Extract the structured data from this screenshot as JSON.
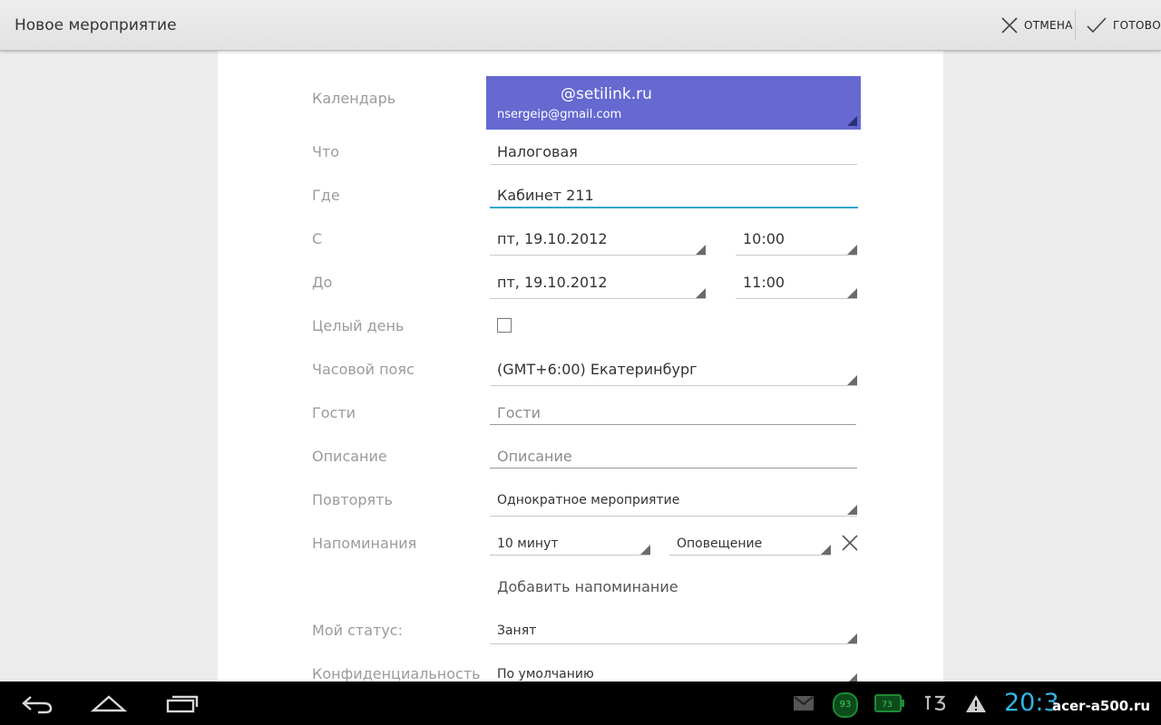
{
  "actionbar": {
    "title": "Новое мероприятие",
    "cancel_label": "ОТМЕНА",
    "done_label": "ГОТОВО"
  },
  "form": {
    "calendar": {
      "label": "Календарь",
      "name": "@setilink.ru",
      "account": "nsergeip@gmail.com",
      "color": "#6569d0"
    },
    "what": {
      "label": "Что",
      "value": "Налоговая"
    },
    "where": {
      "label": "Где",
      "value": "Кабинет 211"
    },
    "from": {
      "label": "С",
      "date": "пт, 19.10.2012",
      "time": "10:00"
    },
    "to": {
      "label": "До",
      "date": "пт, 19.10.2012",
      "time": "11:00"
    },
    "all_day": {
      "label": "Целый день",
      "checked": false
    },
    "timezone": {
      "label": "Часовой пояс",
      "value": "(GMT+6:00) Екатеринбург"
    },
    "guests": {
      "label": "Гости",
      "placeholder": "Гости"
    },
    "description": {
      "label": "Описание",
      "placeholder": "Описание"
    },
    "repeat": {
      "label": "Повторять",
      "value": "Однократное мероприятие"
    },
    "reminders": {
      "label": "Напоминания",
      "time": "10 минут",
      "method": "Оповещение",
      "add_label": "Добавить напоминание"
    },
    "status": {
      "label": "Мой статус:",
      "value": "Занят"
    },
    "privacy": {
      "label": "Конфиденциальность",
      "value": "По умолчанию"
    }
  },
  "statusbar": {
    "clock": "20:3",
    "gmail_icon": "gmail-icon",
    "badge1": "93",
    "battery_level": "73",
    "watermark": "acer-a500.ru",
    "accent": "#33b5e5"
  }
}
